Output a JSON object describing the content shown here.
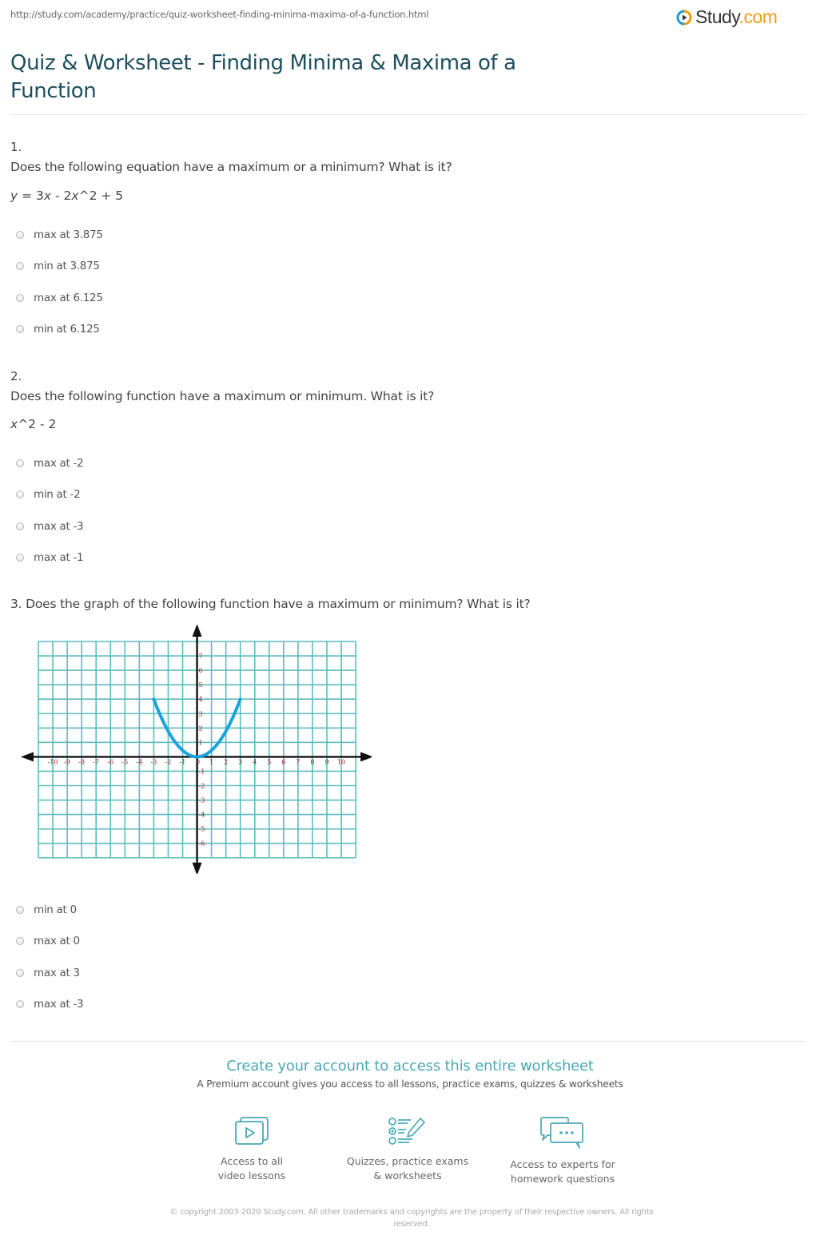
{
  "page": {
    "url": "http://study.com/academy/practice/quiz-worksheet-finding-minima-maxima-of-a-function.html",
    "logo": {
      "name": "Study",
      "suffix": ".com",
      "icon": "play-circle-icon"
    },
    "title": "Quiz & Worksheet - Finding Minima & Maxima of a Function"
  },
  "questions": [
    {
      "number": "1.",
      "text": "Does the following equation have a maximum or a minimum? What is it?",
      "formula": "y = 3x - 2x^2 + 5",
      "options": [
        "max at 3.875",
        "min at 3.875",
        "max at 6.125",
        "min at 6.125"
      ]
    },
    {
      "number": "2.",
      "text": "Does the following function have a maximum or minimum. What is it?",
      "formula": "x^2 - 2",
      "options": [
        "max at -2",
        "min at -2",
        "max at -3",
        "max at -1"
      ]
    },
    {
      "number": "3.",
      "text": "3. Does the graph of the following function have a maximum or minimum? What is it?",
      "options": [
        "min at 0",
        "max at 0",
        "max at 3",
        "max at -3"
      ]
    }
  ],
  "chart_data": {
    "type": "line",
    "title": "",
    "xlabel": "",
    "ylabel": "",
    "xlim": [
      -11,
      11
    ],
    "ylim": [
      -7,
      8
    ],
    "grid": true,
    "x_ticks": [
      -10,
      -9,
      -8,
      -7,
      -6,
      -5,
      -4,
      -3,
      -2,
      -1,
      0,
      1,
      2,
      3,
      4,
      5,
      6,
      7,
      8,
      9,
      10
    ],
    "y_ticks": [
      7,
      6,
      5,
      4,
      3,
      2,
      1,
      -1,
      -2,
      -3,
      -4,
      -5,
      -6
    ],
    "series": [
      {
        "name": "parabola",
        "function": "y = (4/9) x^2",
        "x": [
          -3,
          -2,
          -1,
          0,
          1,
          2,
          3
        ],
        "y": [
          4,
          1.78,
          0.44,
          0,
          0.44,
          1.78,
          4
        ],
        "color": "#1aa3dc"
      }
    ],
    "colors": {
      "grid": "#5bbcbf",
      "axis": "#111111",
      "tick_label": "#a02020"
    }
  },
  "cta": {
    "title": "Create your account to access this entire worksheet",
    "subtitle": "A Premium account gives you access to all lessons, practice exams, quizzes & worksheets",
    "features": [
      {
        "icon": "video-lessons-icon",
        "line1": "Access to all",
        "line2": "video lessons"
      },
      {
        "icon": "quiz-checklist-icon",
        "line1": "Quizzes, practice exams",
        "line2": "& worksheets"
      },
      {
        "icon": "chat-bubbles-icon",
        "line1": "Access to experts for",
        "line2": "homework questions"
      }
    ]
  },
  "footer": {
    "copyright": "© copyright 2003-2020 Study.com. All other trademarks and copyrights are the property of their respective owners. All rights reserved."
  },
  "colors": {
    "title": "#1e4f5e",
    "accent": "#4aa8b6",
    "logo_orange": "#f39c12",
    "logo_blue": "#1a9bd7"
  }
}
